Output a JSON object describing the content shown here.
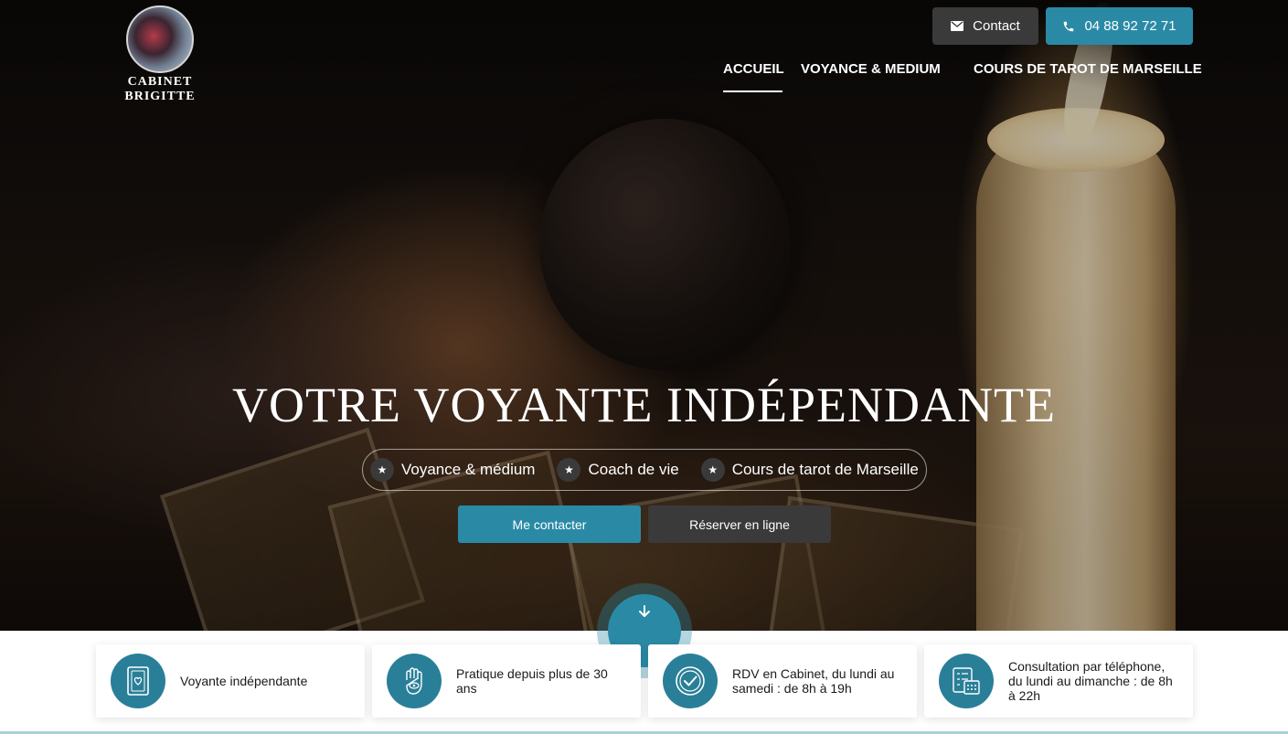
{
  "brand": {
    "name": "CABINET  BRIGITTE"
  },
  "header": {
    "contact_label": "Contact",
    "phone_label": "04 88 92 72 71",
    "nav": [
      {
        "label": "ACCUEIL",
        "active": true
      },
      {
        "label": "VOYANCE & MEDIUM"
      },
      {
        "label": "COURS DE TAROT DE MARSEILLE"
      }
    ]
  },
  "hero": {
    "title": "VOTRE VOYANTE INDÉPENDANTE",
    "tags": [
      "Voyance & médium",
      "Coach de vie",
      "Cours de tarot de Marseille"
    ],
    "cta_primary": "Me contacter",
    "cta_secondary": "Réserver en ligne"
  },
  "features": [
    {
      "icon": "tarot-card-icon",
      "text": "Voyante indépendante"
    },
    {
      "icon": "hand-eye-icon",
      "text": "Pratique depuis plus de 30 ans"
    },
    {
      "icon": "checkmark-circle-icon",
      "text": "RDV en Cabinet, du lundi au samedi : de 8h à 19h"
    },
    {
      "icon": "calendar-checklist-icon",
      "text": "Consultation par téléphone, du lundi au dimanche : de 8h à 22h"
    }
  ],
  "colors": {
    "accent": "#2a8aa6",
    "dark_button": "#3a3a3a",
    "feature_icon_bg": "#2a7f98"
  }
}
